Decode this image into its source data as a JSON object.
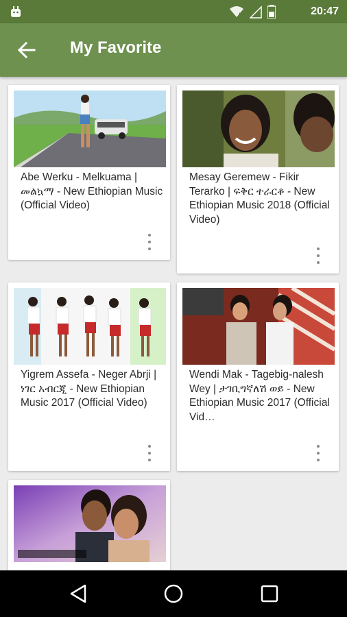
{
  "status_bar": {
    "time": "20:47",
    "icons": [
      "android-icon",
      "wifi-icon",
      "signal-icon",
      "battery-icon"
    ]
  },
  "app_bar": {
    "title": "My Favorite",
    "icon": "arrow-back-icon"
  },
  "videos": [
    {
      "title": "Abe Werku - Melkuama | መልኳማ - New Ethiopian Music (Official Video)"
    },
    {
      "title": "Mesay Geremew - Fikir Terarko | ፍቅር ተራርቆ - New Ethiopian Music 2018 (Official Video)"
    },
    {
      "title": "Yigrem Assefa - Neger Abrji | ነገር አብርጂ - New Ethiopian Music 2017 (Official Video)"
    },
    {
      "title": "Wendi Mak - Tagebig-nalesh Wey | ታገቢግኛለሽ ወይ - New Ethiopian Music 2017 (Official Vid…"
    },
    {
      "title": ""
    }
  ],
  "nav_bar": {
    "icons": [
      "back-triangle-icon",
      "home-circle-icon",
      "recents-square-icon"
    ]
  }
}
